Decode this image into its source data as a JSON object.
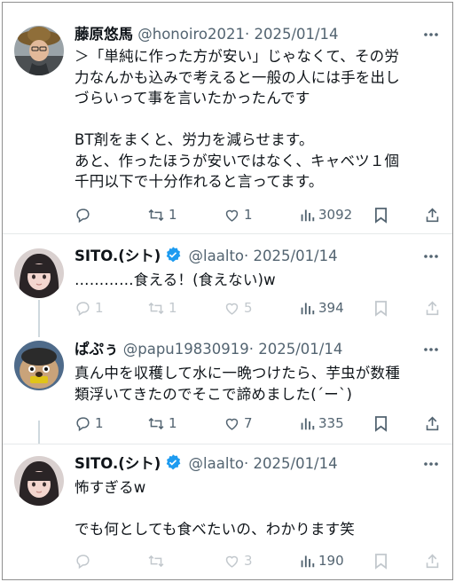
{
  "tweets": [
    {
      "name": "藤原悠馬",
      "handle": "@honoiro2021",
      "date": "2025/01/14",
      "verified": false,
      "text": "＞「単純に作った方が安い」じゃなくて、その労\n力なんかも込みで考えると一般の人には手を出し\nづらいって事を言いたかったんです\n\nBT剤をまくと、労力を減らせます。\nあと、作ったほうが安いではなく、キャベツ１個\n千円以下で十分作れると言ってます。",
      "stats": {
        "replies": "",
        "reposts": "1",
        "likes": "1",
        "views": "3092"
      }
    },
    {
      "name": "SITO.(シト)",
      "handle": "@laalto",
      "date": "2025/01/14",
      "verified": true,
      "text": "…………食える！(食えない)w",
      "stats": {
        "replies": "1",
        "reposts": "1",
        "likes": "5",
        "views": "394"
      }
    },
    {
      "name": "ぱぷぅ",
      "handle": "@papu19830919",
      "date": "2025/01/14",
      "verified": false,
      "text": "真ん中を収穫して水に一晩つけたら、芋虫が数種\n類浮いてきたのでそこで諦めました(´ー`)",
      "stats": {
        "replies": "1",
        "reposts": "1",
        "likes": "7",
        "views": "335"
      }
    },
    {
      "name": "SITO.(シト)",
      "handle": "@laalto",
      "date": "2025/01/14",
      "verified": true,
      "text": "怖すぎるw\n\nでも何としても食べたいの、わかります笑",
      "stats": {
        "replies": "",
        "reposts": "",
        "likes": "3",
        "views": "190"
      }
    }
  ],
  "separator": "·",
  "colors": {
    "text": "#0f1419",
    "muted": "#536471",
    "verified": "#1d9bf0",
    "divider": "#e6e9ea"
  }
}
